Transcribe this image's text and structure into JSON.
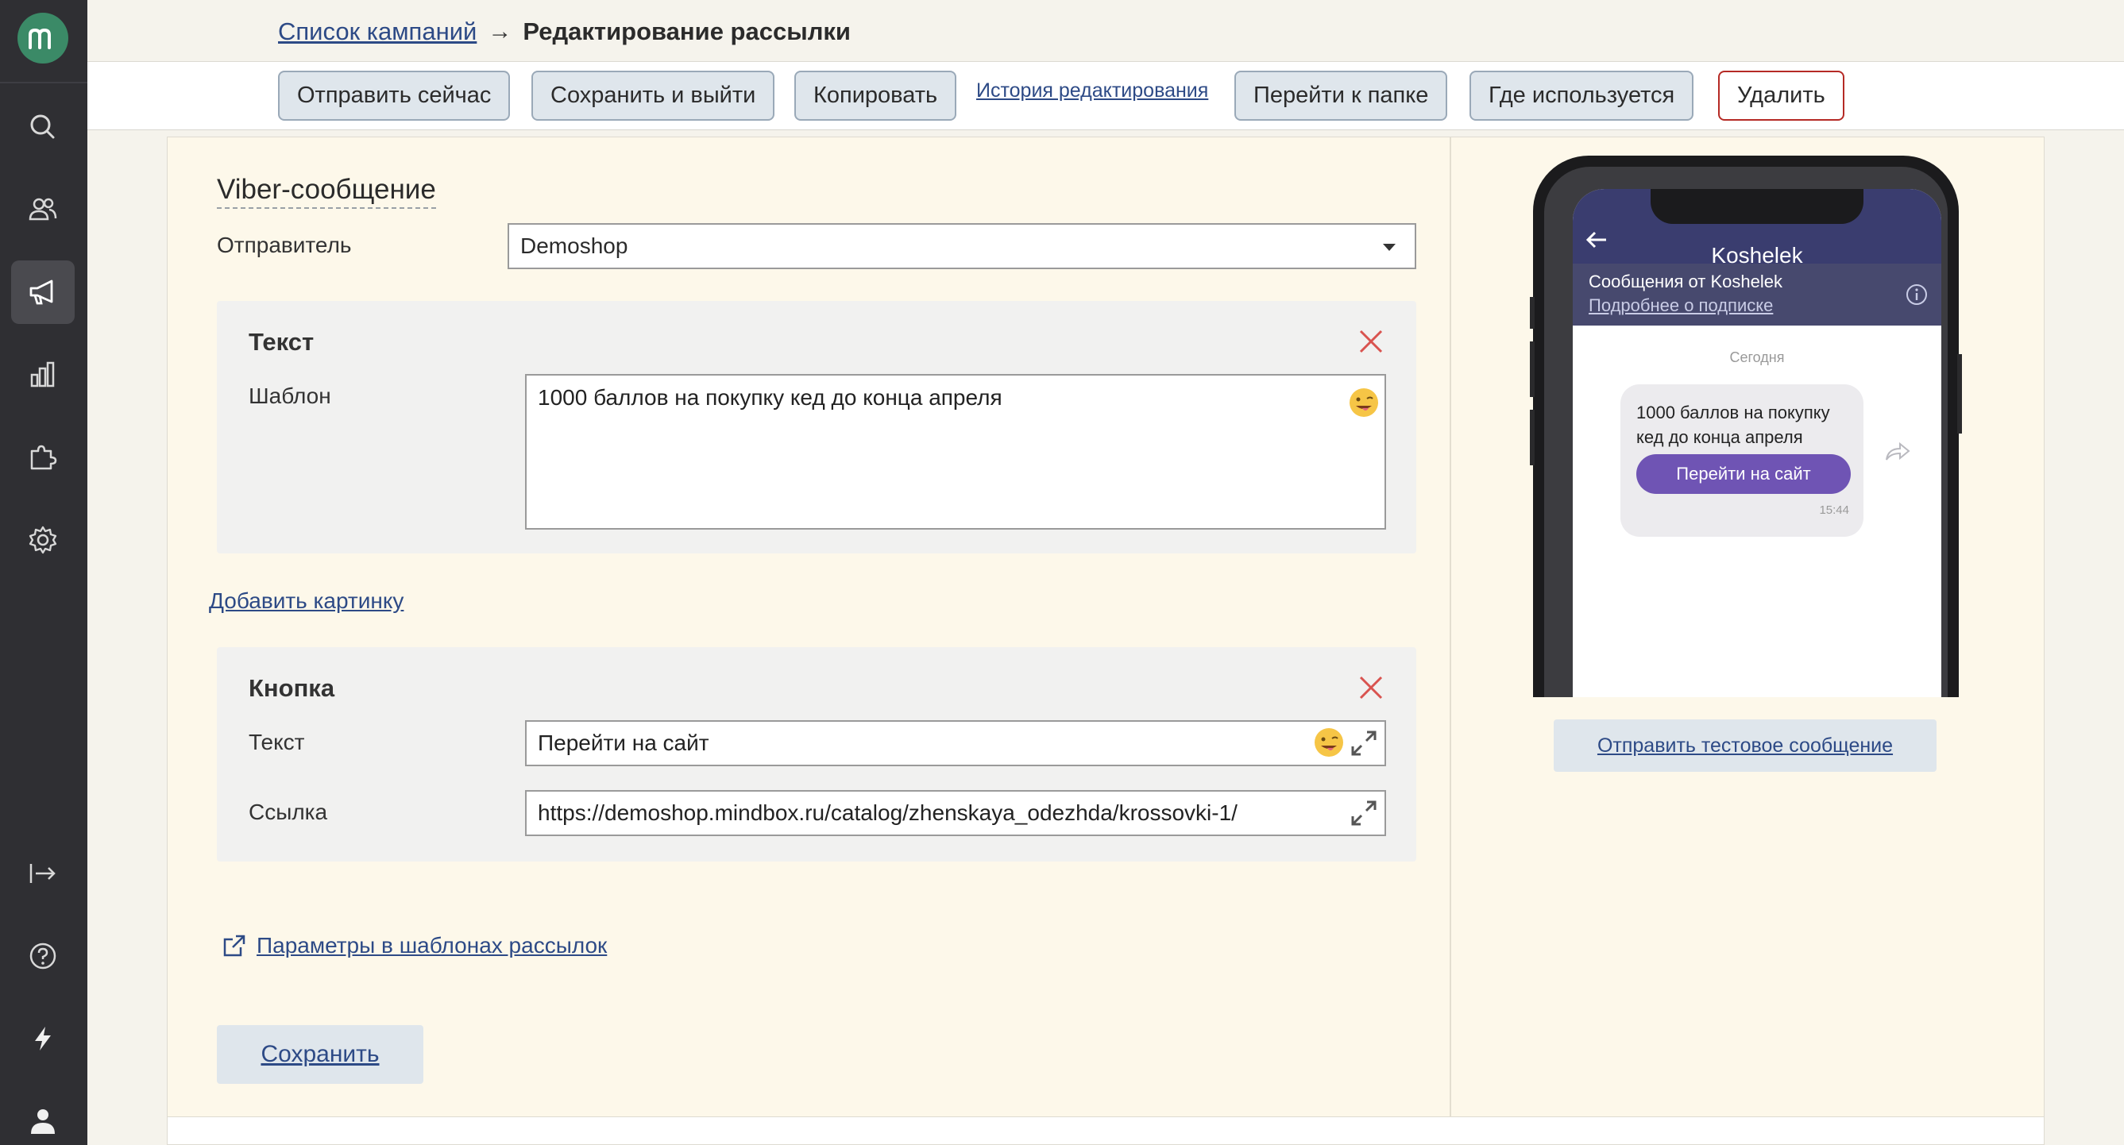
{
  "breadcrumb": {
    "parent": "Список кампаний",
    "arrow": "→",
    "current": "Редактирование рассылки"
  },
  "toolbar": {
    "send_now": "Отправить сейчас",
    "save_exit": "Сохранить и выйти",
    "copy": "Копировать",
    "history": "История редактирования",
    "go_folder": "Перейти к папке",
    "where_used": "Где используется",
    "delete": "Удалить"
  },
  "form": {
    "section_title": "Viber-сообщение",
    "sender_label": "Отправитель",
    "sender_value": "Demoshop",
    "text_block": {
      "title": "Текст",
      "template_label": "Шаблон",
      "template_value": "1000 баллов на покупку кед до конца апреля"
    },
    "add_image": "Добавить картинку",
    "button_block": {
      "title": "Кнопка",
      "text_label": "Текст",
      "text_value": "Перейти на сайт",
      "link_label": "Ссылка",
      "link_value": "https://demoshop.mindbox.ru/catalog/zhenskaya_odezhda/krossovki-1/"
    },
    "params_link": "Параметры в шаблонах рассылок",
    "save": "Сохранить"
  },
  "preview": {
    "title": "Koshelek",
    "subscription": "Сообщения от Koshelek",
    "subscription_link": "Подробнее о подписке",
    "date_label": "Сегодня",
    "message": "1000 баллов на покупку кед до конца апреля",
    "button": "Перейти на сайт",
    "time": "15:44",
    "test_button": "Отправить тестовое сообщение"
  },
  "colors": {
    "sidebar": "#2f2f33",
    "logo": "#3b8a67",
    "link": "#2d4a86",
    "danger": "#b52a25",
    "viber_header": "#3a3d6f",
    "viber_button": "#6f54b4"
  }
}
